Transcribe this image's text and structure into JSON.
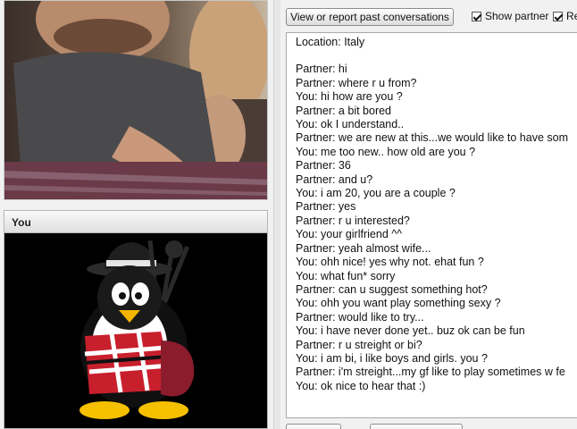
{
  "partner_video": {
    "description_icon": "partner-webcam-feed"
  },
  "you_panel": {
    "header": "You"
  },
  "toolbar": {
    "report_label": "View or report past conversations",
    "show_partner_label": "Show partner",
    "second_option_label": "Re"
  },
  "log": {
    "location": "Location: Italy",
    "messages": [
      "Partner: hi",
      "Partner: where r u from?",
      "You: hi how are you ?",
      "Partner: a bit bored",
      "You: ok I understand..",
      "Partner: we are new at this...we would like to have som",
      "You: me too new.. how old are you ?",
      "Partner: 36",
      "Partner: and u?",
      "You: i am 20, you are a couple ?",
      "Partner: yes",
      "Partner: r u interested?",
      "You: your girlfriend ^^",
      "Partner: yeah almost wife...",
      "You: ohh nice! yes why not. ehat fun ?",
      "You: what fun* sorry",
      "Partner: can u suggest something hot?",
      "You: ohh you want play something sexy ?",
      "Partner: would like to try...",
      "You: i have never done yet.. buz ok can be fun",
      "Partner: r u streight or bi?",
      "You: i am bi, i like boys and girls. you ?",
      "Partner: i'm streight...my gf like to play sometimes w fe",
      "You: ok nice to hear that :)"
    ]
  }
}
